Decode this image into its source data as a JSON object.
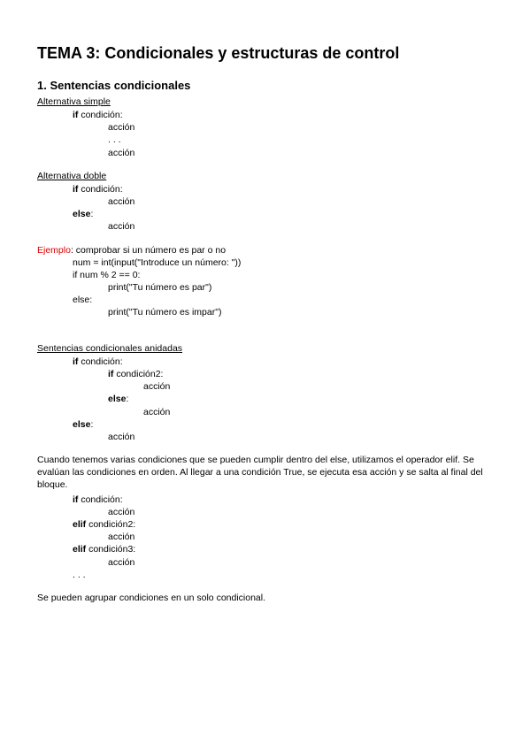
{
  "title": "TEMA 3: Condicionales y estructuras de control",
  "section1": {
    "heading": "1. Sentencias condicionales",
    "altSimple": {
      "label": "Alternativa simple",
      "l1a": "if ",
      "l1b": "condición:",
      "l2": "acción",
      "l3": ". . .",
      "l4": "acción"
    },
    "altDoble": {
      "label": "Alternativa doble",
      "l1a": "if ",
      "l1b": "condición:",
      "l2": "acción",
      "l3a": "else",
      "l3b": ":",
      "l4": "acción"
    },
    "ejemplo": {
      "label": "Ejemplo",
      "desc": ": comprobar si un número es par o no",
      "l1": "num = int(input(\"Introduce un número: \"))",
      "l2": "if num % 2 == 0:",
      "l3": "print(\"Tu número es par\")",
      "l4": "else:",
      "l5": "print(\"Tu número es impar\")"
    },
    "anidadas": {
      "label": "Sentencias condicionales anidadas",
      "l1a": "if ",
      "l1b": "condición:",
      "l2a": "if ",
      "l2b": "condición2:",
      "l3": "acción",
      "l4a": "else",
      "l4b": ":",
      "l5": "acción",
      "l6a": "else",
      "l6b": ":",
      "l7": "acción"
    },
    "elif": {
      "para": "Cuando tenemos varias condiciones que se pueden cumplir dentro del else, utilizamos el operador elif. Se evalúan las condiciones en orden. Al llegar a una condición True, se ejecuta esa acción y se salta al final del bloque.",
      "l1a": "if ",
      "l1b": "condición:",
      "l2": "acción",
      "l3a": "elif ",
      "l3b": "condición2:",
      "l4": "acción",
      "l5a": "elif ",
      "l5b": "condición3:",
      "l6": "acción",
      "l7": ". . ."
    },
    "closing": "Se pueden agrupar condiciones en un solo condicional."
  }
}
